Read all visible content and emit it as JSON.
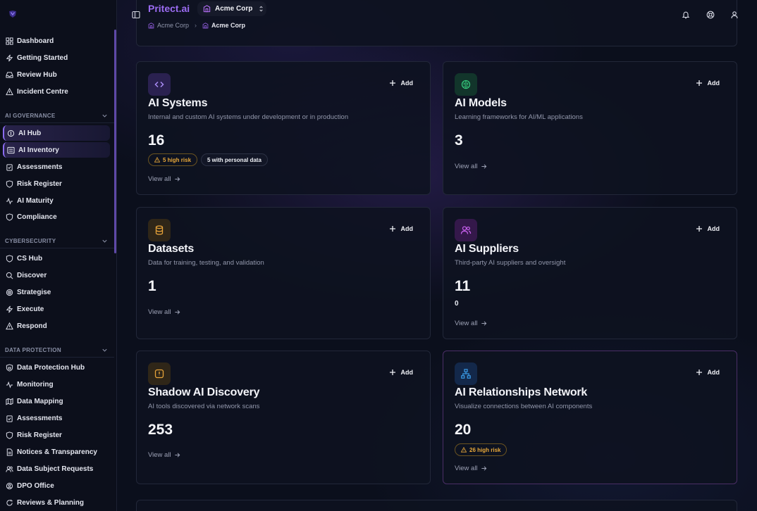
{
  "app": {
    "brand": "Pritect.ai",
    "org_selector": "Acme Corp",
    "breadcrumb": [
      "Acme Corp",
      "Acme Corp"
    ]
  },
  "sidebar": {
    "top_items": [
      {
        "label": "Dashboard",
        "icon": "grid-icon"
      },
      {
        "label": "Getting Started",
        "icon": "bolt-icon"
      },
      {
        "label": "Review Hub",
        "icon": "inbox-icon"
      },
      {
        "label": "Incident Centre",
        "icon": "warning-icon"
      }
    ],
    "sections": [
      {
        "title": "AI GOVERNANCE",
        "items": [
          {
            "label": "AI Hub",
            "icon": "hub-icon",
            "active": true
          },
          {
            "label": "AI Inventory",
            "icon": "list-icon",
            "active": true
          },
          {
            "label": "Assessments",
            "icon": "clipboard-check-icon"
          },
          {
            "label": "Risk Register",
            "icon": "shield-icon"
          },
          {
            "label": "AI Maturity",
            "icon": "activity-icon"
          },
          {
            "label": "Compliance",
            "icon": "shield-outline-icon"
          }
        ]
      },
      {
        "title": "CYBERSECURITY",
        "items": [
          {
            "label": "CS Hub",
            "icon": "shield-icon"
          },
          {
            "label": "Discover",
            "icon": "search-icon"
          },
          {
            "label": "Strategise",
            "icon": "target-icon"
          },
          {
            "label": "Execute",
            "icon": "bolt-icon"
          },
          {
            "label": "Respond",
            "icon": "warning-icon"
          }
        ]
      },
      {
        "title": "DATA PROTECTION",
        "items": [
          {
            "label": "Data Protection Hub",
            "icon": "shield-lock-icon"
          },
          {
            "label": "Monitoring",
            "icon": "activity-icon"
          },
          {
            "label": "Data Mapping",
            "icon": "map-icon"
          },
          {
            "label": "Assessments",
            "icon": "clipboard-check-icon"
          },
          {
            "label": "Risk Register",
            "icon": "shield-icon"
          },
          {
            "label": "Notices & Transparency",
            "icon": "file-icon"
          },
          {
            "label": "Data Subject Requests",
            "icon": "users-icon"
          },
          {
            "label": "DPO Office",
            "icon": "id-badge-icon"
          },
          {
            "label": "Reviews & Planning",
            "icon": "refresh-icon"
          }
        ]
      }
    ]
  },
  "cards": [
    {
      "title": "AI Systems",
      "description": "Internal and custom AI systems under development or in production",
      "count": "16",
      "add_label": "Add",
      "view_all": "View all",
      "badges": [
        {
          "label": "5 high risk",
          "type": "risk"
        },
        {
          "label": "5 with personal data",
          "type": "neutral"
        }
      ],
      "icon": "code-icon",
      "accent": "#a98cf5"
    },
    {
      "title": "AI Models",
      "description": "Learning frameworks for AI/ML applications",
      "count": "3",
      "add_label": "Add",
      "view_all": "View all",
      "icon": "brain-icon",
      "accent": "#34c77b"
    },
    {
      "title": "Datasets",
      "description": "Data for training, testing, and validation",
      "count": "1",
      "add_label": "Add",
      "view_all": "View all",
      "icon": "database-icon",
      "accent": "#e8a43a"
    },
    {
      "title": "AI Suppliers",
      "description": "Third-party AI suppliers and oversight",
      "count": "11",
      "extra_value": "0",
      "add_label": "Add",
      "view_all": "View all",
      "icon": "users-icon",
      "accent": "#c05ce6"
    },
    {
      "title": "Shadow AI Discovery",
      "description": "AI tools discovered via network scans",
      "count": "253",
      "add_label": "Add",
      "view_all": "View all",
      "icon": "alert-square-icon",
      "accent": "#e8a43a"
    },
    {
      "title": "AI Relationships Network",
      "description": "Visualize connections between AI components",
      "count": "20",
      "add_label": "Add",
      "view_all": "View all",
      "badges": [
        {
          "label": "26 high risk",
          "type": "risk"
        }
      ],
      "icon": "network-icon",
      "accent": "#3a9be8"
    }
  ]
}
